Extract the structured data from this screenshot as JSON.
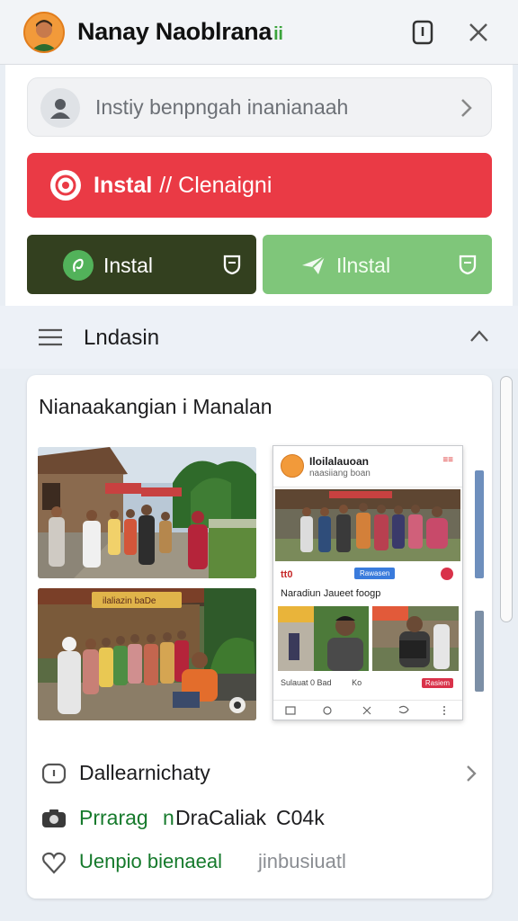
{
  "header": {
    "title": "Nanay Naoblrana",
    "title_tag": "ii",
    "icons": [
      "avatar",
      "phone-icon",
      "close-icon"
    ]
  },
  "search": {
    "text": "Instiy benpngah inanianaah",
    "icon": "user-icon"
  },
  "primary_button": {
    "label": "Instal",
    "sublabel": "// Clenaigni",
    "color": "#ea3a45"
  },
  "secondary_buttons": [
    {
      "label": "Instal",
      "color": "#33401f",
      "icon": "leaf-icon",
      "end_icon": "shield-icon"
    },
    {
      "label": "Ilnstal",
      "color": "#7fc67a",
      "icon": "send-icon",
      "end_icon": "shield-icon"
    }
  ],
  "section": {
    "title": "Lndasin"
  },
  "card": {
    "title": "Nianaakangian i Manalan",
    "preview": {
      "name": "Iloilalauoan",
      "sub": "naasiiang boan",
      "mark": "≡≡",
      "code": "tt0",
      "badge": "Rawasen",
      "caption": "Naradiun Jaueet foogp",
      "footer_left": "Sulauat 0 Bad",
      "footer_mid": "Ko",
      "footer_right": "Rasiem"
    },
    "rows": [
      {
        "text": "Dallearnichaty",
        "icon": "chat-icon",
        "color": "#1d1d1f",
        "has_chevron": true
      },
      {
        "text_a": "Prrarag",
        "text_b": "n",
        "text_c": "DraCaliak",
        "text_d": "C04k",
        "icon": "camera-icon",
        "color": "#167a2c"
      },
      {
        "text_a": "Uenpio bienaeal",
        "text_b": "jinbusiuatl",
        "icon": "heart-icon",
        "color": "#167a2c"
      }
    ]
  },
  "colors": {
    "accent_red": "#ea3a45",
    "dark_green": "#33401f",
    "light_green": "#7fc67a",
    "text_green": "#167a2c"
  }
}
